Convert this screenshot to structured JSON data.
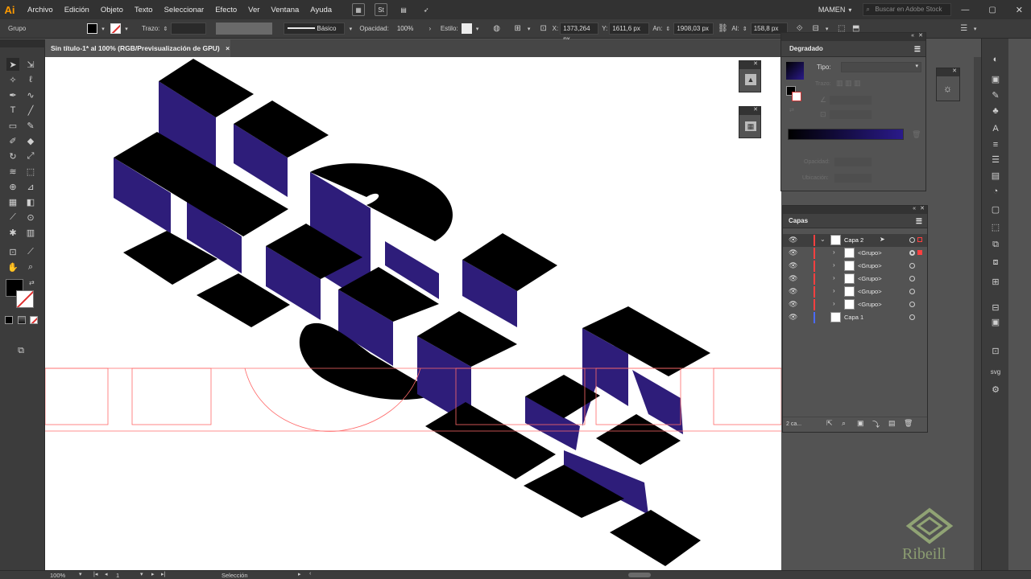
{
  "app": {
    "logo": "Ai",
    "brand_color": "#ff9a00"
  },
  "menu": {
    "items": [
      "Archivo",
      "Edición",
      "Objeto",
      "Texto",
      "Seleccionar",
      "Efecto",
      "Ver",
      "Ventana",
      "Ayuda"
    ],
    "bridge_icon": "St",
    "workspace": "MAMEN",
    "search_placeholder": "Buscar en Adobe Stock"
  },
  "control": {
    "selection_type": "Grupo",
    "stroke_label": "Trazo:",
    "brush_label": "Básico",
    "opacity_label": "Opacidad:",
    "opacity_value": "100%",
    "style_label": "Estilo:",
    "x_label": "X:",
    "x_value": "1373,264 px",
    "y_label": "Y:",
    "y_value": "1611,6 px",
    "w_label": "An:",
    "w_value": "1908,03 px",
    "h_label": "Al:",
    "h_value": "158,8 px"
  },
  "document": {
    "tab_title": "Sin título-1* al 100% (RGB/Previsualización de GPU)",
    "close": "×"
  },
  "gradient_panel": {
    "title": "Degradado",
    "type_label": "Tipo:",
    "stroke_label": "Trazo:",
    "opacity_label": "Opacidad:",
    "location_label": "Ubicación:",
    "start_color": "#000000",
    "end_color": "#2a1a8a"
  },
  "layers_panel": {
    "title": "Capas",
    "footer_text": "2 ca...",
    "rows": [
      {
        "name": "Capa 2",
        "expanded": true,
        "selected": true
      },
      {
        "name": "<Grupo>"
      },
      {
        "name": "<Grupo>"
      },
      {
        "name": "<Grupo>"
      },
      {
        "name": "<Grupo>"
      },
      {
        "name": "<Grupo>"
      },
      {
        "name": "Capa 1"
      }
    ],
    "layer_colors": {
      "capa2": "#ff4040",
      "capa1": "#4a6aff"
    }
  },
  "status": {
    "zoom": "100%",
    "artboard": "1",
    "tool": "Selección"
  },
  "watermark": {
    "text": "Ribeill",
    "color": "#b9d98a"
  },
  "art": {
    "face_color": "#000000",
    "side_color": "#2e1d7a",
    "guide_color": "#ff6a6a"
  }
}
